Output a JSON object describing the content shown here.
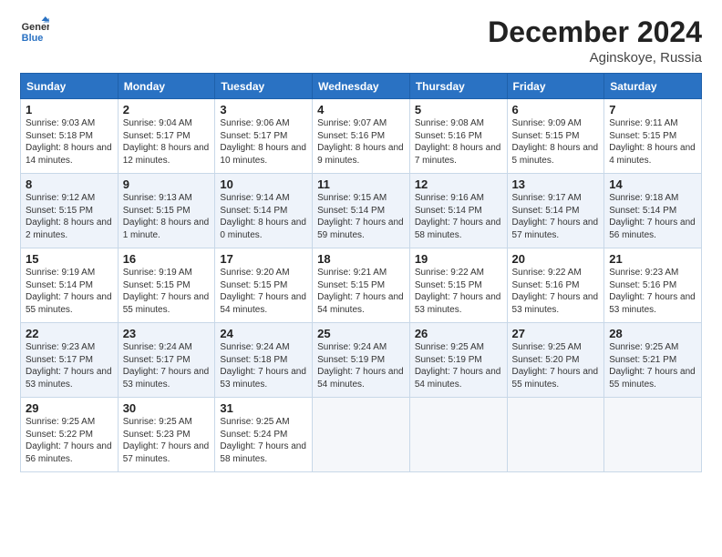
{
  "logo": {
    "line1": "General",
    "line2": "Blue",
    "icon_color": "#2a72c3"
  },
  "title": "December 2024",
  "location": "Aginskoye, Russia",
  "days_of_week": [
    "Sunday",
    "Monday",
    "Tuesday",
    "Wednesday",
    "Thursday",
    "Friday",
    "Saturday"
  ],
  "weeks": [
    [
      {
        "day": "1",
        "sunrise": "Sunrise: 9:03 AM",
        "sunset": "Sunset: 5:18 PM",
        "daylight": "Daylight: 8 hours and 14 minutes."
      },
      {
        "day": "2",
        "sunrise": "Sunrise: 9:04 AM",
        "sunset": "Sunset: 5:17 PM",
        "daylight": "Daylight: 8 hours and 12 minutes."
      },
      {
        "day": "3",
        "sunrise": "Sunrise: 9:06 AM",
        "sunset": "Sunset: 5:17 PM",
        "daylight": "Daylight: 8 hours and 10 minutes."
      },
      {
        "day": "4",
        "sunrise": "Sunrise: 9:07 AM",
        "sunset": "Sunset: 5:16 PM",
        "daylight": "Daylight: 8 hours and 9 minutes."
      },
      {
        "day": "5",
        "sunrise": "Sunrise: 9:08 AM",
        "sunset": "Sunset: 5:16 PM",
        "daylight": "Daylight: 8 hours and 7 minutes."
      },
      {
        "day": "6",
        "sunrise": "Sunrise: 9:09 AM",
        "sunset": "Sunset: 5:15 PM",
        "daylight": "Daylight: 8 hours and 5 minutes."
      },
      {
        "day": "7",
        "sunrise": "Sunrise: 9:11 AM",
        "sunset": "Sunset: 5:15 PM",
        "daylight": "Daylight: 8 hours and 4 minutes."
      }
    ],
    [
      {
        "day": "8",
        "sunrise": "Sunrise: 9:12 AM",
        "sunset": "Sunset: 5:15 PM",
        "daylight": "Daylight: 8 hours and 2 minutes."
      },
      {
        "day": "9",
        "sunrise": "Sunrise: 9:13 AM",
        "sunset": "Sunset: 5:15 PM",
        "daylight": "Daylight: 8 hours and 1 minute."
      },
      {
        "day": "10",
        "sunrise": "Sunrise: 9:14 AM",
        "sunset": "Sunset: 5:14 PM",
        "daylight": "Daylight: 8 hours and 0 minutes."
      },
      {
        "day": "11",
        "sunrise": "Sunrise: 9:15 AM",
        "sunset": "Sunset: 5:14 PM",
        "daylight": "Daylight: 7 hours and 59 minutes."
      },
      {
        "day": "12",
        "sunrise": "Sunrise: 9:16 AM",
        "sunset": "Sunset: 5:14 PM",
        "daylight": "Daylight: 7 hours and 58 minutes."
      },
      {
        "day": "13",
        "sunrise": "Sunrise: 9:17 AM",
        "sunset": "Sunset: 5:14 PM",
        "daylight": "Daylight: 7 hours and 57 minutes."
      },
      {
        "day": "14",
        "sunrise": "Sunrise: 9:18 AM",
        "sunset": "Sunset: 5:14 PM",
        "daylight": "Daylight: 7 hours and 56 minutes."
      }
    ],
    [
      {
        "day": "15",
        "sunrise": "Sunrise: 9:19 AM",
        "sunset": "Sunset: 5:14 PM",
        "daylight": "Daylight: 7 hours and 55 minutes."
      },
      {
        "day": "16",
        "sunrise": "Sunrise: 9:19 AM",
        "sunset": "Sunset: 5:15 PM",
        "daylight": "Daylight: 7 hours and 55 minutes."
      },
      {
        "day": "17",
        "sunrise": "Sunrise: 9:20 AM",
        "sunset": "Sunset: 5:15 PM",
        "daylight": "Daylight: 7 hours and 54 minutes."
      },
      {
        "day": "18",
        "sunrise": "Sunrise: 9:21 AM",
        "sunset": "Sunset: 5:15 PM",
        "daylight": "Daylight: 7 hours and 54 minutes."
      },
      {
        "day": "19",
        "sunrise": "Sunrise: 9:22 AM",
        "sunset": "Sunset: 5:15 PM",
        "daylight": "Daylight: 7 hours and 53 minutes."
      },
      {
        "day": "20",
        "sunrise": "Sunrise: 9:22 AM",
        "sunset": "Sunset: 5:16 PM",
        "daylight": "Daylight: 7 hours and 53 minutes."
      },
      {
        "day": "21",
        "sunrise": "Sunrise: 9:23 AM",
        "sunset": "Sunset: 5:16 PM",
        "daylight": "Daylight: 7 hours and 53 minutes."
      }
    ],
    [
      {
        "day": "22",
        "sunrise": "Sunrise: 9:23 AM",
        "sunset": "Sunset: 5:17 PM",
        "daylight": "Daylight: 7 hours and 53 minutes."
      },
      {
        "day": "23",
        "sunrise": "Sunrise: 9:24 AM",
        "sunset": "Sunset: 5:17 PM",
        "daylight": "Daylight: 7 hours and 53 minutes."
      },
      {
        "day": "24",
        "sunrise": "Sunrise: 9:24 AM",
        "sunset": "Sunset: 5:18 PM",
        "daylight": "Daylight: 7 hours and 53 minutes."
      },
      {
        "day": "25",
        "sunrise": "Sunrise: 9:24 AM",
        "sunset": "Sunset: 5:19 PM",
        "daylight": "Daylight: 7 hours and 54 minutes."
      },
      {
        "day": "26",
        "sunrise": "Sunrise: 9:25 AM",
        "sunset": "Sunset: 5:19 PM",
        "daylight": "Daylight: 7 hours and 54 minutes."
      },
      {
        "day": "27",
        "sunrise": "Sunrise: 9:25 AM",
        "sunset": "Sunset: 5:20 PM",
        "daylight": "Daylight: 7 hours and 55 minutes."
      },
      {
        "day": "28",
        "sunrise": "Sunrise: 9:25 AM",
        "sunset": "Sunset: 5:21 PM",
        "daylight": "Daylight: 7 hours and 55 minutes."
      }
    ],
    [
      {
        "day": "29",
        "sunrise": "Sunrise: 9:25 AM",
        "sunset": "Sunset: 5:22 PM",
        "daylight": "Daylight: 7 hours and 56 minutes."
      },
      {
        "day": "30",
        "sunrise": "Sunrise: 9:25 AM",
        "sunset": "Sunset: 5:23 PM",
        "daylight": "Daylight: 7 hours and 57 minutes."
      },
      {
        "day": "31",
        "sunrise": "Sunrise: 9:25 AM",
        "sunset": "Sunset: 5:24 PM",
        "daylight": "Daylight: 7 hours and 58 minutes."
      },
      null,
      null,
      null,
      null
    ]
  ]
}
